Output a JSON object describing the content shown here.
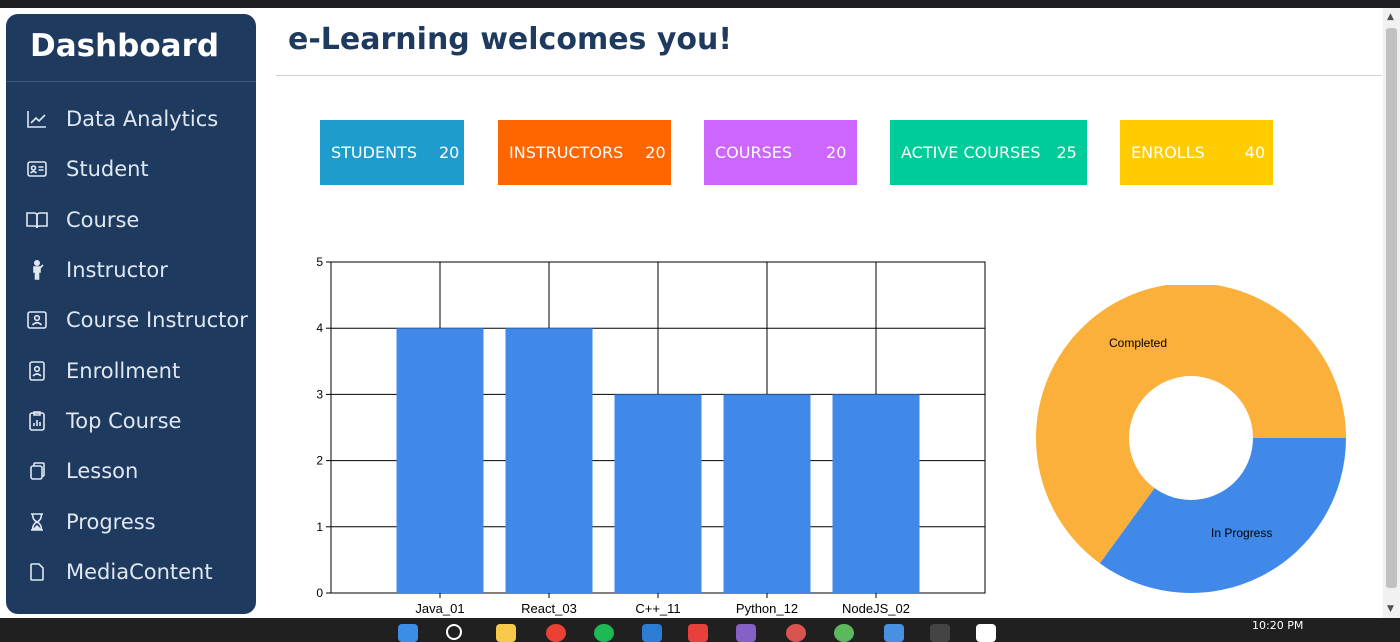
{
  "sidebar": {
    "title": "Dashboard",
    "items": [
      {
        "label": "Data Analytics",
        "icon": "line-chart-icon"
      },
      {
        "label": "Student",
        "icon": "id-card-icon"
      },
      {
        "label": "Course",
        "icon": "book-icon"
      },
      {
        "label": "Instructor",
        "icon": "person-icon"
      },
      {
        "label": "Course Instructor",
        "icon": "presentation-icon"
      },
      {
        "label": "Enrollment",
        "icon": "badge-icon"
      },
      {
        "label": "Top Course",
        "icon": "report-icon"
      },
      {
        "label": "Lesson",
        "icon": "copy-icon"
      },
      {
        "label": "Progress",
        "icon": "hourglass-icon"
      },
      {
        "label": "MediaContent",
        "icon": "file-icon"
      }
    ]
  },
  "header": {
    "title": "e-Learning welcomes you!"
  },
  "stats": [
    {
      "label": "STUDENTS",
      "value": "20",
      "color": "#1e9ccd"
    },
    {
      "label": "INSTRUCTORS",
      "value": "20",
      "color": "#ff6600"
    },
    {
      "label": "COURSES",
      "value": "20",
      "color": "#cc66ff"
    },
    {
      "label": "ACTIVE COURSES",
      "value": "25",
      "color": "#00cc99"
    },
    {
      "label": "ENROLLS",
      "value": "40",
      "color": "#ffcc00"
    }
  ],
  "chart_data": [
    {
      "type": "bar",
      "categories": [
        "Java_01",
        "React_03",
        "C++_11",
        "Python_12",
        "NodeJS_02"
      ],
      "values": [
        4,
        4,
        3,
        3,
        3
      ],
      "ylim": [
        0,
        5
      ],
      "yticks": [
        "0",
        "1",
        "2",
        "3",
        "4",
        "5"
      ],
      "grid": true,
      "bar_color": "#4189e9"
    },
    {
      "type": "pie",
      "labels": [
        "Completed",
        "In Progress"
      ],
      "values": [
        65,
        35
      ],
      "colors": [
        "#fbb03b",
        "#4189e9"
      ],
      "donut": true
    }
  ],
  "taskbar": {
    "time": "10:20 PM"
  }
}
